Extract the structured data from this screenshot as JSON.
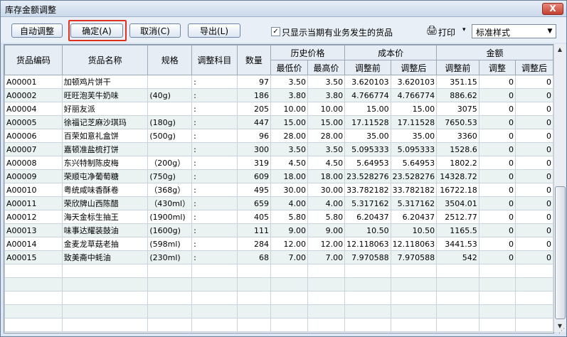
{
  "window": {
    "title": "库存金额调整",
    "close_label": "X"
  },
  "toolbar": {
    "auto_adjust": "自动调整",
    "confirm": "确定(A)",
    "cancel": "取消(C)",
    "export": "导出(L)",
    "checkbox_label": "只显示当期有业务发生的货品",
    "checkbox_checked": true,
    "print_label": "打印",
    "print_arrow": "▾",
    "style_value": "标准样式"
  },
  "grid": {
    "headers": {
      "code": "货品编码",
      "name": "货品名称",
      "spec": "规格",
      "subject": "调整科目",
      "qty": "数量",
      "hist": "历史价格",
      "cost": "成本价",
      "amount": "金额",
      "hist_low": "最低价",
      "hist_high": "最高价",
      "cost_before": "调整前",
      "cost_after": "调整后",
      "amt_before": "调整前",
      "amt_adjust": "调整",
      "amt_after": "调整后"
    },
    "rows": [
      [
        "A00001",
        "加顿鸡片饼干",
        "",
        ":",
        "97",
        "3.50",
        "3.50",
        "3.620103",
        "3.620103",
        "351.15",
        "0",
        "0"
      ],
      [
        "A00002",
        "旺旺泡芙牛奶味",
        "(40g)",
        ":",
        "186",
        "3.80",
        "3.80",
        "4.766774",
        "4.766774",
        "886.62",
        "0",
        "0"
      ],
      [
        "A00004",
        "好丽友派",
        "",
        ":",
        "205",
        "10.00",
        "10.00",
        "15.00",
        "15.00",
        "3075",
        "0",
        "0"
      ],
      [
        "A00005",
        "徐福记芝麻沙琪玛",
        "(180g)",
        ":",
        "447",
        "15.00",
        "15.00",
        "17.11528",
        "17.11528",
        "7650.53",
        "0",
        "0"
      ],
      [
        "A00006",
        "百荣如意礼盒饼",
        "(500g)",
        ":",
        "96",
        "28.00",
        "28.00",
        "35.00",
        "35.00",
        "3360",
        "0",
        "0"
      ],
      [
        "A00007",
        "嘉顿准盐梳打饼",
        "",
        ":",
        "300",
        "3.50",
        "3.50",
        "5.095333",
        "5.095333",
        "1528.6",
        "0",
        "0"
      ],
      [
        "A00008",
        "东兴特制陈皮梅",
        "（200g）",
        ":",
        "319",
        "4.50",
        "4.50",
        "5.64953",
        "5.64953",
        "1802.2",
        "0",
        "0"
      ],
      [
        "A00009",
        "荣顺屯净葡萄糖",
        "(750g)",
        ":",
        "609",
        "18.00",
        "18.00",
        "23.528276",
        "23.528276",
        "14328.72",
        "0",
        "0"
      ],
      [
        "A00010",
        "粤统咸味香酥卷",
        "（368g）",
        ":",
        "495",
        "30.00",
        "30.00",
        "33.782182",
        "33.782182",
        "16722.18",
        "0",
        "0"
      ],
      [
        "A00011",
        "荣欣牌山西陈醋",
        "（430ml）",
        ":",
        "659",
        "4.00",
        "4.00",
        "5.317162",
        "5.317162",
        "3504.01",
        "0",
        "0"
      ],
      [
        "A00012",
        "海天金标生抽王",
        "(1900ml)",
        ":",
        "405",
        "5.80",
        "5.80",
        "6.20437",
        "6.20437",
        "2512.77",
        "0",
        "0"
      ],
      [
        "A00013",
        "味事达耀装鼓油",
        "(1600g)",
        ":",
        "111",
        "9.00",
        "9.00",
        "10.50",
        "10.50",
        "1165.5",
        "0",
        "0"
      ],
      [
        "A00014",
        "金麦龙草菇老抽",
        "(598ml)",
        ":",
        "284",
        "12.00",
        "12.00",
        "12.118063",
        "12.118063",
        "3441.53",
        "0",
        "0"
      ],
      [
        "A00015",
        "致美斋中蚝油",
        "(230ml)",
        ":",
        "68",
        "7.00",
        "7.00",
        "7.970588",
        "7.970588",
        "542",
        "0",
        "0"
      ]
    ],
    "empty_rows": 5
  },
  "colors": {
    "accent_red": "#e0301e",
    "row_alt": "#eaf2f2",
    "header_bg": "#e6edf5"
  }
}
